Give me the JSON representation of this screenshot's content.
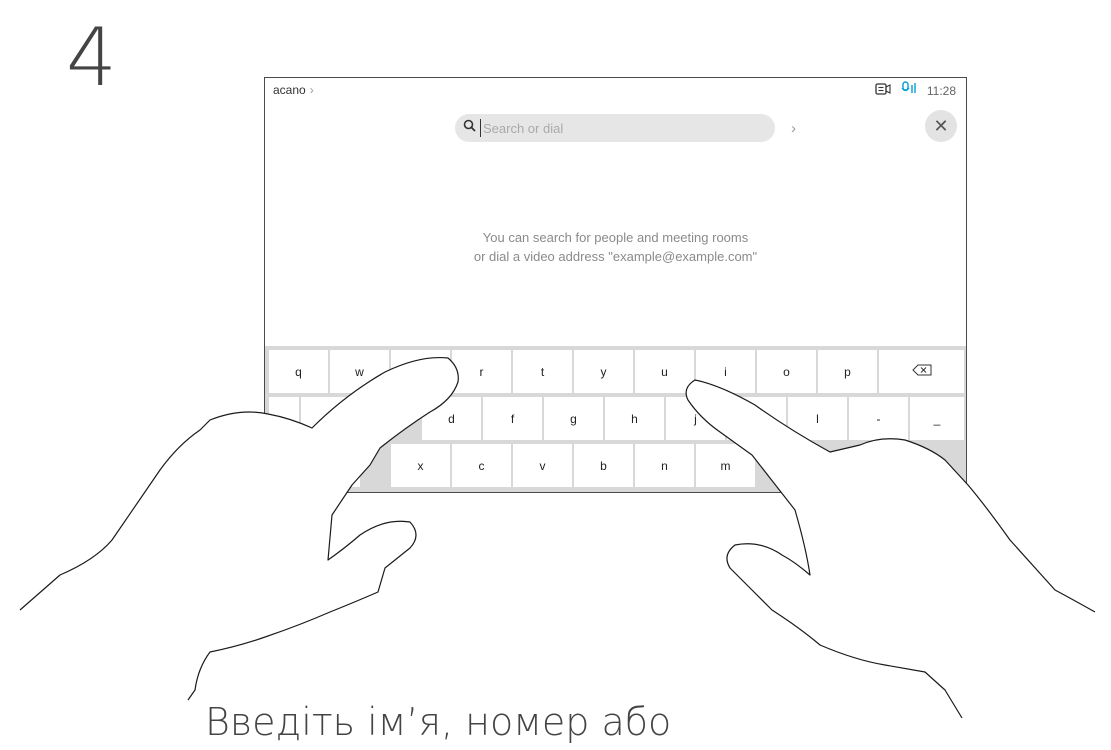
{
  "step": {
    "number": "4"
  },
  "device": {
    "status_bar": {
      "breadcrumb": "acano",
      "clock": "11:28",
      "icons": [
        "camera-screen-icon",
        "microphone-icon"
      ]
    },
    "search": {
      "placeholder": "Search or dial"
    },
    "hint": {
      "line1": "You can search for people and meeting rooms",
      "line2": "or dial a video address \"example@example.com\""
    },
    "keyboard": {
      "row1": [
        "q",
        "w",
        "",
        "r",
        "t",
        "y",
        "u",
        "i",
        "o",
        "p"
      ],
      "row2": [
        "",
        "",
        "d",
        "f",
        "g",
        "h",
        "j",
        "",
        "l",
        "-",
        "_"
      ],
      "row3": [
        "",
        "x",
        "c",
        "v",
        "b",
        "n",
        "m"
      ]
    }
  },
  "caption": {
    "text": "Введіть ім’я, номер або"
  },
  "colors": {
    "accent": "#049fd9",
    "keyboard_bg": "#d8d8d8",
    "pill_bg": "#e6e6e6"
  }
}
